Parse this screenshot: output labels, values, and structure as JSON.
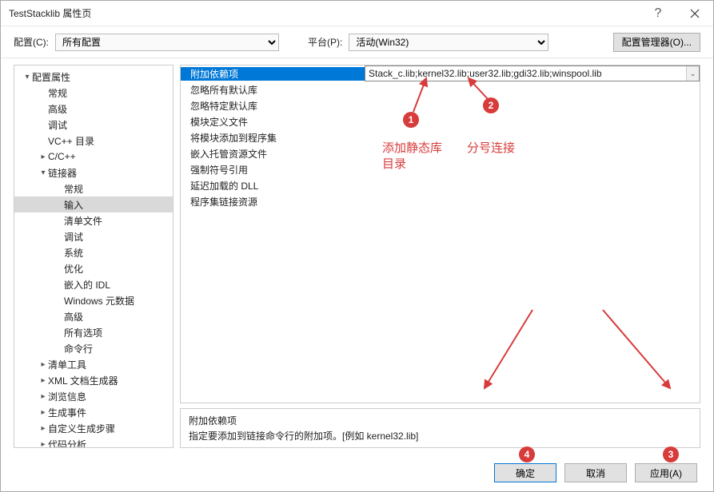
{
  "window": {
    "title": "TestStacklib 属性页",
    "help_tip": "?",
    "close_tip": "×"
  },
  "toolbar": {
    "config_label": "配置(C):",
    "config_value": "所有配置",
    "platform_label": "平台(P):",
    "platform_value": "活动(Win32)",
    "cfg_mgr_label": "配置管理器(O)..."
  },
  "tree": [
    {
      "label": "配置属性",
      "lvl": 1,
      "arrow": "▾"
    },
    {
      "label": "常规",
      "lvl": 2
    },
    {
      "label": "高级",
      "lvl": 2
    },
    {
      "label": "调试",
      "lvl": 2
    },
    {
      "label": "VC++ 目录",
      "lvl": 2
    },
    {
      "label": "C/C++",
      "lvl": 2,
      "arrow": "▸"
    },
    {
      "label": "链接器",
      "lvl": 2,
      "arrow": "▾"
    },
    {
      "label": "常规",
      "lvl": 3
    },
    {
      "label": "输入",
      "lvl": 3,
      "sel": true
    },
    {
      "label": "清单文件",
      "lvl": 3
    },
    {
      "label": "调试",
      "lvl": 3
    },
    {
      "label": "系统",
      "lvl": 3
    },
    {
      "label": "优化",
      "lvl": 3
    },
    {
      "label": "嵌入的 IDL",
      "lvl": 3
    },
    {
      "label": "Windows 元数据",
      "lvl": 3
    },
    {
      "label": "高级",
      "lvl": 3
    },
    {
      "label": "所有选项",
      "lvl": 3
    },
    {
      "label": "命令行",
      "lvl": 3
    },
    {
      "label": "清单工具",
      "lvl": 2,
      "arrow": "▸"
    },
    {
      "label": "XML 文档生成器",
      "lvl": 2,
      "arrow": "▸"
    },
    {
      "label": "浏览信息",
      "lvl": 2,
      "arrow": "▸"
    },
    {
      "label": "生成事件",
      "lvl": 2,
      "arrow": "▸"
    },
    {
      "label": "自定义生成步骤",
      "lvl": 2,
      "arrow": "▸"
    },
    {
      "label": "代码分析",
      "lvl": 2,
      "arrow": "▸"
    }
  ],
  "props": [
    {
      "label": "附加依赖项",
      "value": "Stack_c.lib;kernel32.lib;user32.lib;gdi32.lib;winspool.lib",
      "sel": true
    },
    {
      "label": "忽略所有默认库",
      "value": ""
    },
    {
      "label": "忽略特定默认库",
      "value": ""
    },
    {
      "label": "模块定义文件",
      "value": ""
    },
    {
      "label": "将模块添加到程序集",
      "value": ""
    },
    {
      "label": "嵌入托管资源文件",
      "value": ""
    },
    {
      "label": "强制符号引用",
      "value": ""
    },
    {
      "label": "延迟加载的 DLL",
      "value": ""
    },
    {
      "label": "程序集链接资源",
      "value": ""
    }
  ],
  "desc": {
    "title": "附加依赖项",
    "text": "指定要添加到链接命令行的附加项。[例如 kernel32.lib]"
  },
  "footer": {
    "ok": "确定",
    "cancel": "取消",
    "apply": "应用(A)"
  },
  "annotations": {
    "n1": "1",
    "n2": "2",
    "n3": "3",
    "n4": "4",
    "t1a": "添加静态库",
    "t1b": "目录",
    "t2": "分号连接"
  }
}
